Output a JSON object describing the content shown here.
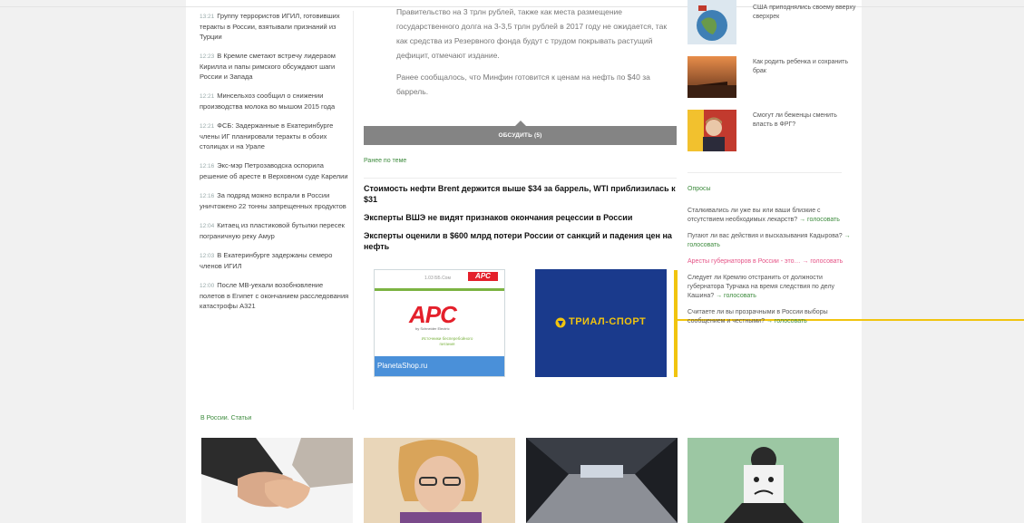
{
  "left_news": [
    {
      "time": "13:21",
      "text": "Группу террористов ИГИЛ, готовивших теракты в России, взятывали признаний из Турции"
    },
    {
      "time": "12:23",
      "text": "В Кремле сметают встречу лидераом Кирилла и папы римского обсуждают шаги России и Запада"
    },
    {
      "time": "12:21",
      "text": "Минсельхоз сообщил о снижении производства молока во мышом 2015 года"
    },
    {
      "time": "12:21",
      "text": "ФСБ: Задержанные в Екатеринбурге члены ИГ планировали теракты в обоих столицах и на Урале"
    },
    {
      "time": "12:16",
      "text": "Экс-мэр Петрозаводска оспорила решение об аресте в Верховном суде Карелии"
    },
    {
      "time": "12:16",
      "text": "За подряд можно вспрали в России уничтожено 22 тонны запрещенных продуктов"
    },
    {
      "time": "12:04",
      "text": "Китаец из пластиковой бутылки пересек пограничную реку Амур"
    },
    {
      "time": "12:03",
      "text": "В Екатеринбурге задержаны семеро членов ИГИЛ"
    },
    {
      "time": "12:00",
      "text": "После МВ-уехали возобновление полетов в Египет с окончанием расследования катастрофы A321"
    }
  ],
  "left_more_link": "В России. Статьи",
  "article": {
    "paragraphs": [
      "Правительство на 3 трлн рублей, также как места размещение государственного долга на 3-3,5 трлн рублей в 2017 году не ожидается, так как средства из Резервного фонда будут с трудом покрывать растущий дефицит, отмечают издание.",
      "Ранее сообщалось, что Минфин готовится к ценам на нефть по $40 за баррель."
    ],
    "discuss_label": "ОБСУДИТЬ (5)"
  },
  "related": {
    "heading": "Ранее по теме",
    "items": [
      "Стоимость нефти Brent держится выше $34 за баррель, WTI приблизилась к $31",
      "Эксперты ВШЭ не видят признаков окончания рецессии в России",
      "Эксперты оценили в $600 млрд потери России от санкций и падения цен на нефть"
    ]
  },
  "ads": {
    "apc": {
      "sub": "1.03 ББ.Сом",
      "mini": "APC",
      "logo": "APC",
      "by": "by Schneider Electric",
      "caption": "Источники бесперебойного питания",
      "footer": "PlanetaShop.ru"
    },
    "tri": {
      "text": "ТРИАЛ-СПОРТ"
    }
  },
  "right_thumbs": [
    {
      "text": "США приподнялись своему вверху сверхрек"
    },
    {
      "text": "Как родить ребенка и сохранить брак"
    },
    {
      "text": "Смогут ли беженцы сменить власть в ФРГ?"
    }
  ],
  "polls": {
    "heading": "Опросы",
    "items": [
      {
        "q": "Сталкивались ли уже вы или ваши близкие с отсутствием необходимых лекарств?",
        "vote": "→ голосовать",
        "pink": false
      },
      {
        "q": "Пугают ли вас действия и высказывания Кадырова?",
        "vote": "→ голосовать",
        "pink": false
      },
      {
        "q": "Аресты губернаторов в России - это…",
        "vote": "→ голосовать",
        "pink": true
      },
      {
        "q": "Следует ли Кремлю отстранить от должности губернатора Турчака на время следствия по делу Кашина?",
        "vote": "→ голосовать",
        "pink": false
      },
      {
        "q": "Считаете ли вы прозрачными в России выборы сообщением и честными?",
        "vote": "→ голосовать",
        "pink": false
      }
    ]
  },
  "colors": {
    "accent_green": "#3d8b3d",
    "discuss_gray": "#848484",
    "highlight_yellow": "#f1c40f",
    "poll_pink": "#e55487"
  }
}
